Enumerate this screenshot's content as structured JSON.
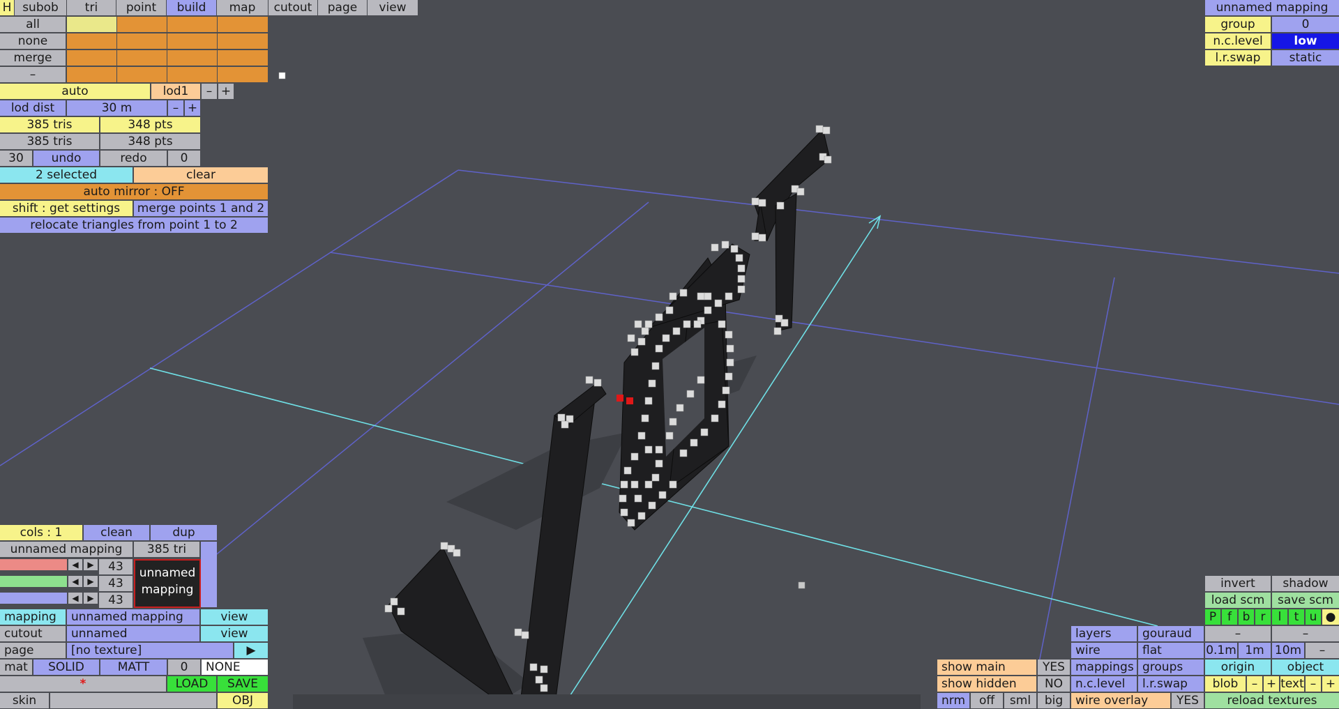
{
  "menu": {
    "help": "H",
    "tabs": [
      "subob",
      "tri",
      "point",
      "build",
      "map",
      "cutout",
      "page",
      "view"
    ],
    "active_tab": "build"
  },
  "selection_groups": {
    "labels": [
      "all",
      "none",
      "merge",
      "–"
    ]
  },
  "lod": {
    "mode": "auto",
    "level": "lod1",
    "minus": "–",
    "plus": "+",
    "dist_label": "lod dist",
    "dist_value": "30 m"
  },
  "stats": [
    {
      "tris": "385 tris",
      "pts": "348 pts"
    },
    {
      "tris": "385 tris",
      "pts": "348 pts"
    }
  ],
  "history": {
    "undo_count": "30",
    "undo": "undo",
    "redo": "redo",
    "redo_count": "0"
  },
  "selection": {
    "count": "2 selected",
    "clear": "clear",
    "mirror": "auto mirror : OFF",
    "get_settings": "shift : get settings",
    "merge": "merge points 1 and 2",
    "relocate": "relocate triangles from point 1 to 2"
  },
  "top_right": {
    "title": "unnamed mapping",
    "group_label": "group",
    "group_value": "0",
    "nclevel_label": "n.c.level",
    "nclevel_value": "low",
    "lrswap_label": "l.r.swap",
    "lrswap_value": "static"
  },
  "color_panel": {
    "cols": "cols : 1",
    "clean": "clean",
    "dup": "dup",
    "mapping_name": "unnamed mapping",
    "tri_count": "385 tri",
    "rgb": [
      "43",
      "43",
      "43"
    ],
    "preview_line1": "unnamed",
    "preview_line2": "mapping"
  },
  "bottom_left": {
    "mapping_label": "mapping",
    "mapping_value": "unnamed mapping",
    "mapping_view": "view",
    "cutout_label": "cutout",
    "cutout_value": "unnamed",
    "cutout_view": "view",
    "page_label": "page",
    "page_value": "[no texture]",
    "mat_label": "mat",
    "mat_solid": "SOLID",
    "mat_matt": "MATT",
    "mat_num": "0",
    "mat_none": "NONE",
    "star": "*",
    "load": "LOAD",
    "save": "SAVE",
    "skin": "skin",
    "obj": "OBJ"
  },
  "bottom_right": {
    "invert": "invert",
    "shadow": "shadow",
    "load_scm": "load scm",
    "save_scm": "save scm",
    "letters": [
      "P",
      "f",
      "b",
      "r",
      "l",
      "t",
      "u",
      "●"
    ],
    "layers": "layers",
    "gouraud": "gouraud",
    "dash": "–",
    "wire": "wire",
    "flat": "flat",
    "m01": "0.1m",
    "m1": "1m",
    "m10": "10m",
    "mappings": "mappings",
    "groups": "groups",
    "origin": "origin",
    "object": "object",
    "nclevel": "n.c.level",
    "lrswap": "l.r.swap",
    "blob": "blob",
    "text": "text",
    "plus": "+",
    "show_main": "show main",
    "show_main_val": "YES",
    "show_hidden": "show hidden",
    "show_hidden_val": "NO",
    "nrm": "nrm",
    "off": "off",
    "sml": "sml",
    "big": "big",
    "wire_overlay": "wire overlay",
    "wire_overlay_val": "YES",
    "reload_textures": "reload textures"
  },
  "colors": {
    "accent_lavender": "#9fa2ef",
    "accent_yellow": "#f7f38a",
    "accent_orange": "#e39336",
    "accent_cyan": "#8be6ef",
    "accent_green": "#38e03a",
    "selected_point": "#e01818"
  }
}
